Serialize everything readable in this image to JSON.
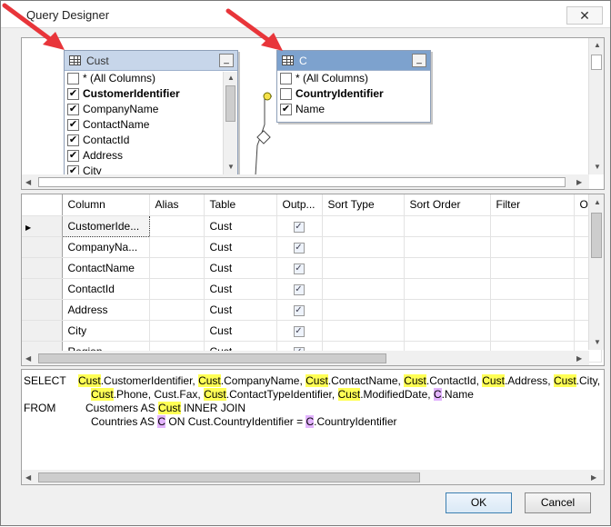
{
  "window": {
    "title": "Query Designer",
    "close_glyph": "✕"
  },
  "diagram": {
    "cust_table": {
      "name": "Cust",
      "columns": [
        {
          "label": "* (All Columns)",
          "checked": false,
          "bold": false
        },
        {
          "label": "CustomerIdentifier",
          "checked": true,
          "bold": true
        },
        {
          "label": "CompanyName",
          "checked": true,
          "bold": false
        },
        {
          "label": "ContactName",
          "checked": true,
          "bold": false
        },
        {
          "label": "ContactId",
          "checked": true,
          "bold": false
        },
        {
          "label": "Address",
          "checked": true,
          "bold": false
        },
        {
          "label": "City",
          "checked": true,
          "bold": false
        }
      ]
    },
    "c_table": {
      "name": "C",
      "columns": [
        {
          "label": "* (All Columns)",
          "checked": false,
          "bold": false
        },
        {
          "label": "CountryIdentifier",
          "checked": false,
          "bold": true
        },
        {
          "label": "Name",
          "checked": true,
          "bold": false
        }
      ]
    },
    "minimize_glyph": "_",
    "check_glyph": "✔"
  },
  "grid": {
    "headers": [
      "Column",
      "Alias",
      "Table",
      "Outp...",
      "Sort Type",
      "Sort Order",
      "Filter",
      "O"
    ],
    "rows": [
      {
        "column": "CustomerIde...",
        "alias": "",
        "table": "Cust",
        "output": true,
        "current": true
      },
      {
        "column": "CompanyNa...",
        "alias": "",
        "table": "Cust",
        "output": true,
        "current": false
      },
      {
        "column": "ContactName",
        "alias": "",
        "table": "Cust",
        "output": true,
        "current": false
      },
      {
        "column": "ContactId",
        "alias": "",
        "table": "Cust",
        "output": true,
        "current": false
      },
      {
        "column": "Address",
        "alias": "",
        "table": "Cust",
        "output": true,
        "current": false
      },
      {
        "column": "City",
        "alias": "",
        "table": "Cust",
        "output": true,
        "current": false
      },
      {
        "column": "Region",
        "alias": "",
        "table": "Cust",
        "output": true,
        "current": false
      }
    ],
    "row_pointer": "▶",
    "check_glyph": "✓"
  },
  "sql": {
    "select_kw": "SELECT",
    "from_kw": "FROM",
    "line1": [
      {
        "t": "Cust",
        "h": "y"
      },
      {
        "t": ".CustomerIdentifier, ",
        "h": ""
      },
      {
        "t": "Cust",
        "h": "y"
      },
      {
        "t": ".CompanyName, ",
        "h": ""
      },
      {
        "t": "Cust",
        "h": "y"
      },
      {
        "t": ".ContactName, ",
        "h": ""
      },
      {
        "t": "Cust",
        "h": "y"
      },
      {
        "t": ".ContactId, ",
        "h": ""
      },
      {
        "t": "Cust",
        "h": "y"
      },
      {
        "t": ".Address, ",
        "h": ""
      },
      {
        "t": "Cust",
        "h": "y"
      },
      {
        "t": ".City, C",
        "h": ""
      }
    ],
    "line2": [
      {
        "t": "Cust",
        "h": "y"
      },
      {
        "t": ".Phone, Cust.Fax, ",
        "h": ""
      },
      {
        "t": "Cust",
        "h": "y"
      },
      {
        "t": ".ContactTypeIdentifier, ",
        "h": ""
      },
      {
        "t": "Cust",
        "h": "y"
      },
      {
        "t": ".ModifiedDate, ",
        "h": ""
      },
      {
        "t": "C",
        "h": "p"
      },
      {
        "t": ".Name",
        "h": ""
      }
    ],
    "line3": [
      {
        "t": "Customers AS ",
        "h": ""
      },
      {
        "t": "Cust",
        "h": "y"
      },
      {
        "t": " INNER JOIN",
        "h": ""
      }
    ],
    "line4": [
      {
        "t": "Countries AS ",
        "h": ""
      },
      {
        "t": "C",
        "h": "p"
      },
      {
        "t": " ON Cust.CountryIdentifier = ",
        "h": ""
      },
      {
        "t": "C",
        "h": "p"
      },
      {
        "t": ".CountryIdentifier",
        "h": ""
      }
    ]
  },
  "buttons": {
    "ok": "OK",
    "cancel": "Cancel"
  },
  "colors": {
    "arrow": "#e8353a",
    "highlight_yellow": "#ffff55",
    "highlight_purple": "#e3b4ff"
  }
}
